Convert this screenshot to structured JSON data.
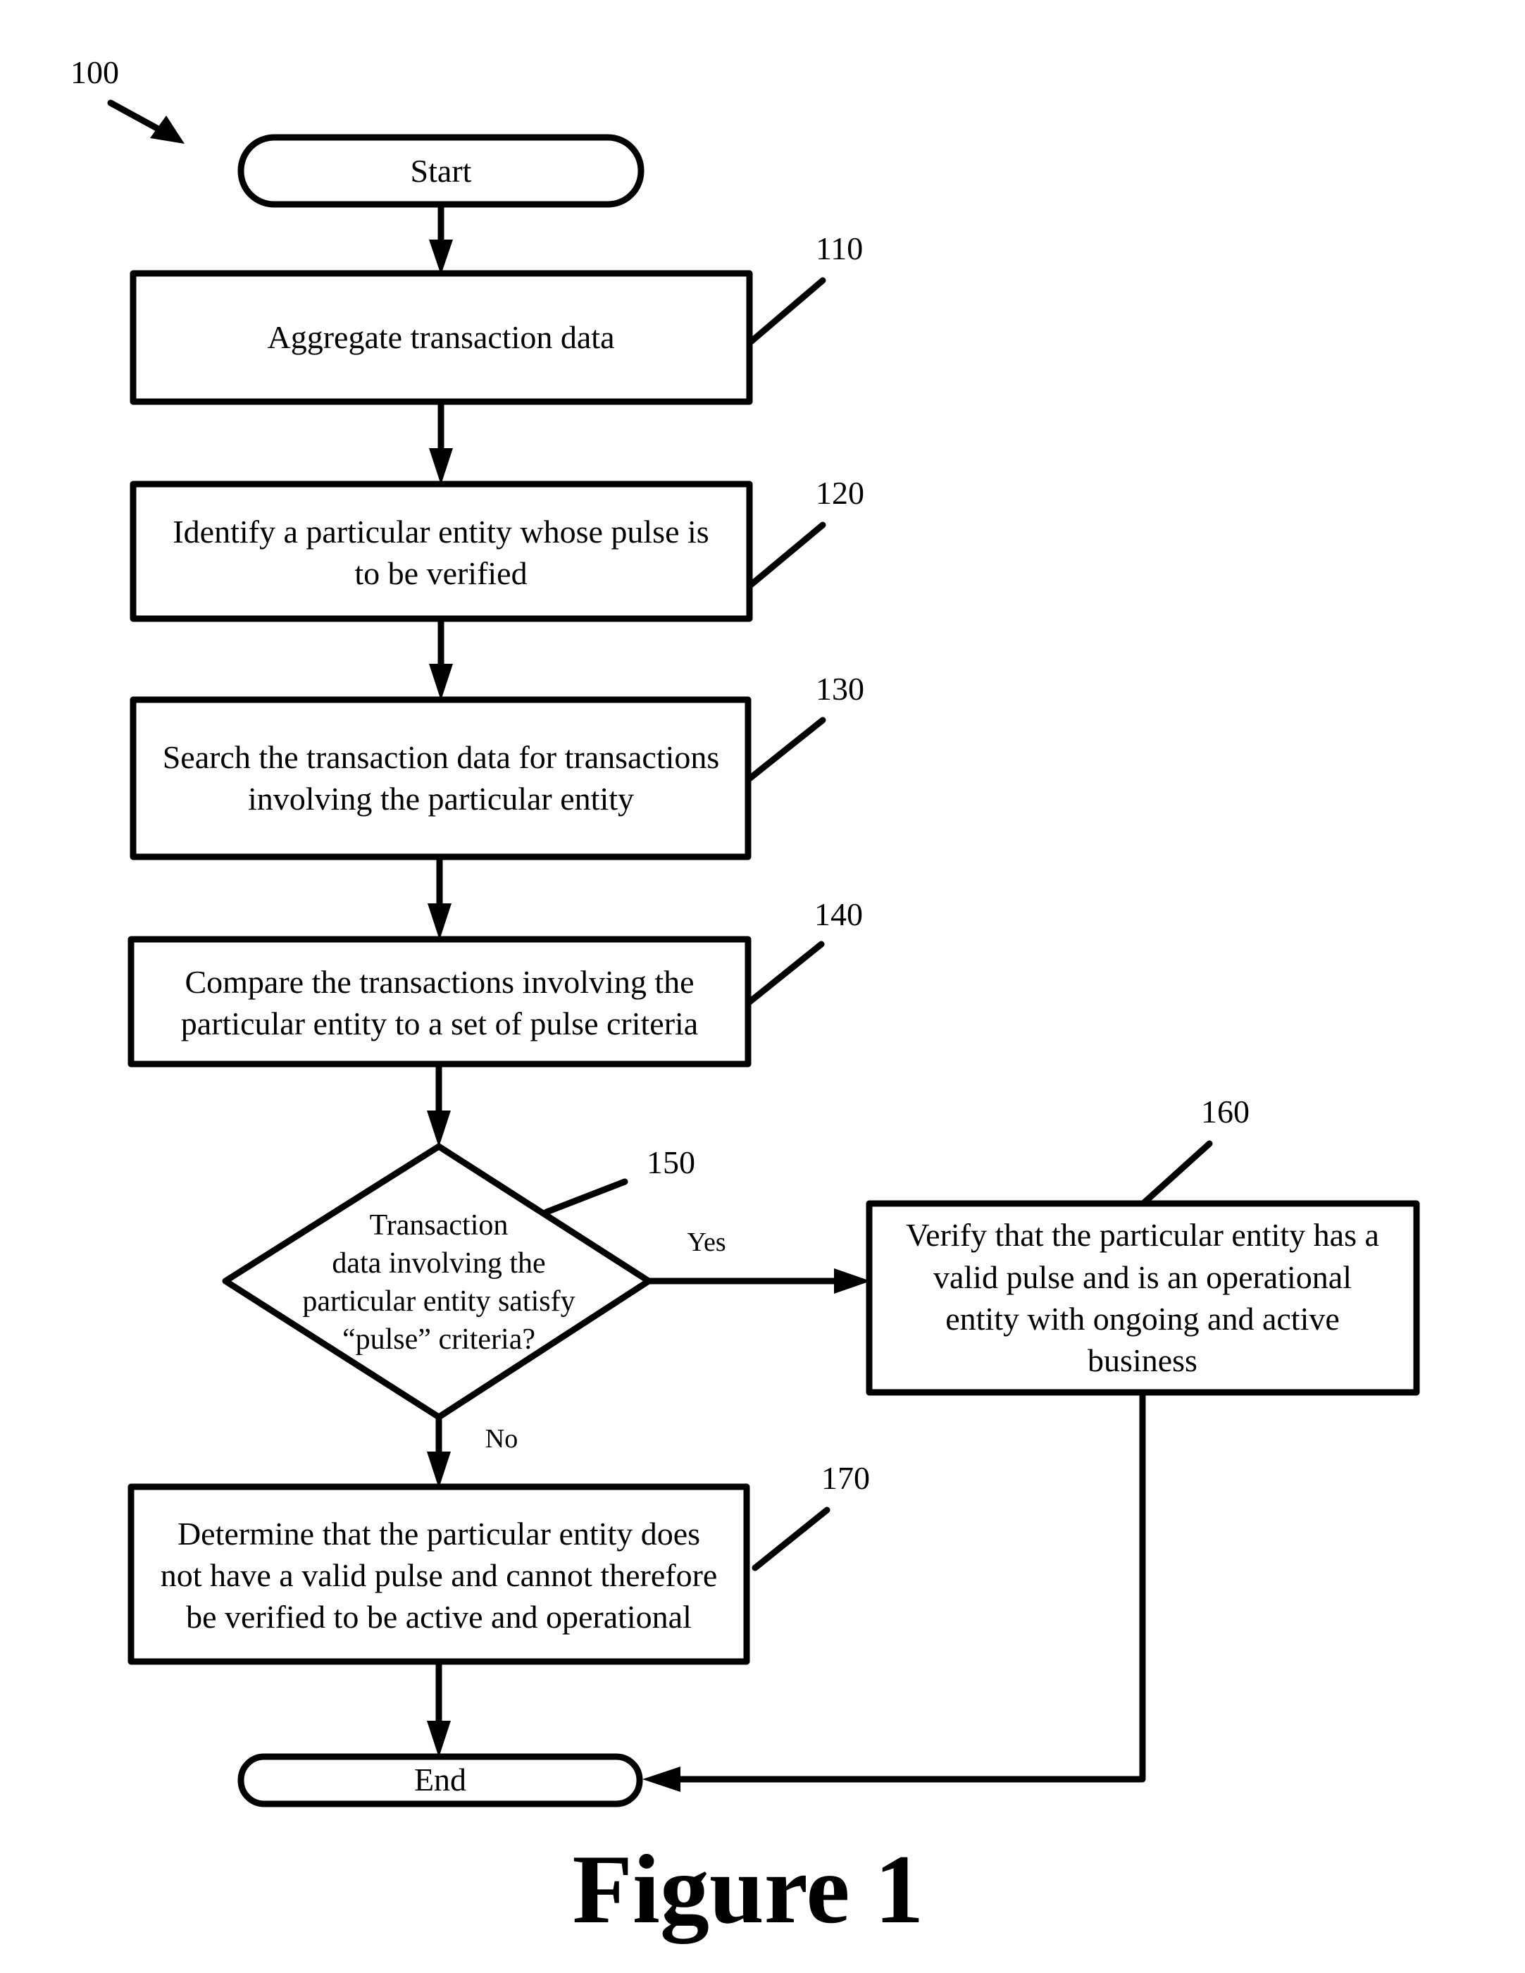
{
  "figure": {
    "reference": "100",
    "caption": "Figure 1"
  },
  "nodes": {
    "start": {
      "label": "Start"
    },
    "end": {
      "label": "End"
    },
    "step110": {
      "ref": "110",
      "lines": [
        "Aggregate transaction data"
      ]
    },
    "step120": {
      "ref": "120",
      "lines": [
        "Identify a particular entity whose pulse is",
        "to be verified"
      ]
    },
    "step130": {
      "ref": "130",
      "lines": [
        "Search the transaction data for transactions",
        "involving the particular entity"
      ]
    },
    "step140": {
      "ref": "140",
      "lines": [
        "Compare the transactions involving the",
        "particular entity to a set of pulse criteria"
      ]
    },
    "decision150": {
      "ref": "150",
      "lines": [
        "Transaction",
        "data involving the",
        "particular entity satisfy",
        "“pulse” criteria?"
      ]
    },
    "step160": {
      "ref": "160",
      "lines": [
        "Verify that the particular entity has a",
        "valid pulse and is an operational",
        "entity with ongoing and active",
        "business"
      ]
    },
    "step170": {
      "ref": "170",
      "lines": [
        "Determine that the particular entity does",
        "not have a valid pulse and cannot therefore",
        "be verified to be active and operational"
      ]
    }
  },
  "edges": {
    "yes_label": "Yes",
    "no_label": "No"
  }
}
